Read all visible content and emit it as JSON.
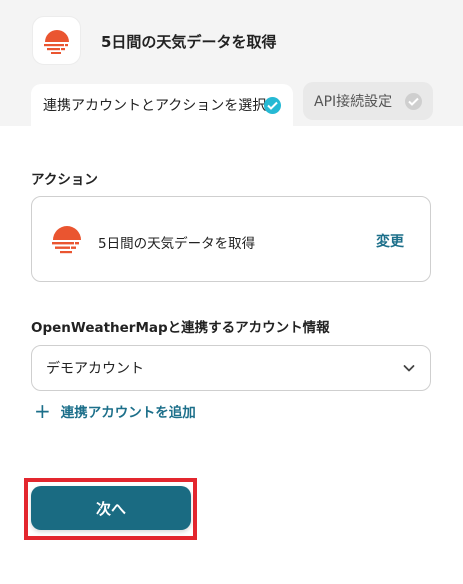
{
  "header": {
    "title": "5日間の天気データを取得",
    "app_icon": "openweather-logo-icon"
  },
  "tabs": [
    {
      "label": "連携アカウントとアクションを選択",
      "state": "active",
      "status_icon": "check-circle-icon"
    },
    {
      "label": "API接続設定",
      "state": "inactive",
      "status_icon": "check-circle-icon"
    }
  ],
  "action_section": {
    "label": "アクション",
    "action_name": "5日間の天気データを取得",
    "change_label": "変更"
  },
  "account_section": {
    "label": "OpenWeatherMapと連携するアカウント情報",
    "selected_value": "デモアカウント",
    "add_label": "連携アカウントを追加"
  },
  "footer": {
    "next_label": "次へ"
  },
  "colors": {
    "accent": "#1a6b82",
    "link": "#1c6f8a",
    "check_active": "#26b9d4",
    "logo": "#ea5530",
    "highlight": "#e3262e"
  }
}
